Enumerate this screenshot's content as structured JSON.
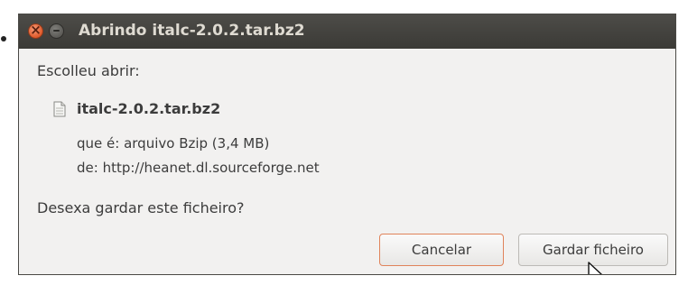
{
  "dialog": {
    "title": "Abrindo italc-2.0.2.tar.bz2",
    "prompt": "Escolleu abrir:",
    "file_name": "italc-2.0.2.tar.bz2",
    "file_type_line": "que é: arquivo Bzip (3,4 MB)",
    "source_line": "de: http://heanet.dl.sourceforge.net",
    "question": "Desexa gardar este ficheiro?",
    "buttons": {
      "cancel_label": "Cancelar",
      "save_label": "Gardar ficheiro"
    }
  },
  "icons": {
    "close": "close-icon",
    "minimize": "minimize-icon",
    "file": "file-icon",
    "cursor": "mouse-pointer-icon"
  },
  "colors": {
    "titlebar": "#3c3b37",
    "close_button": "#e05a2b",
    "default_button_border": "#e0835a",
    "dialog_background": "#f2f1f0"
  }
}
